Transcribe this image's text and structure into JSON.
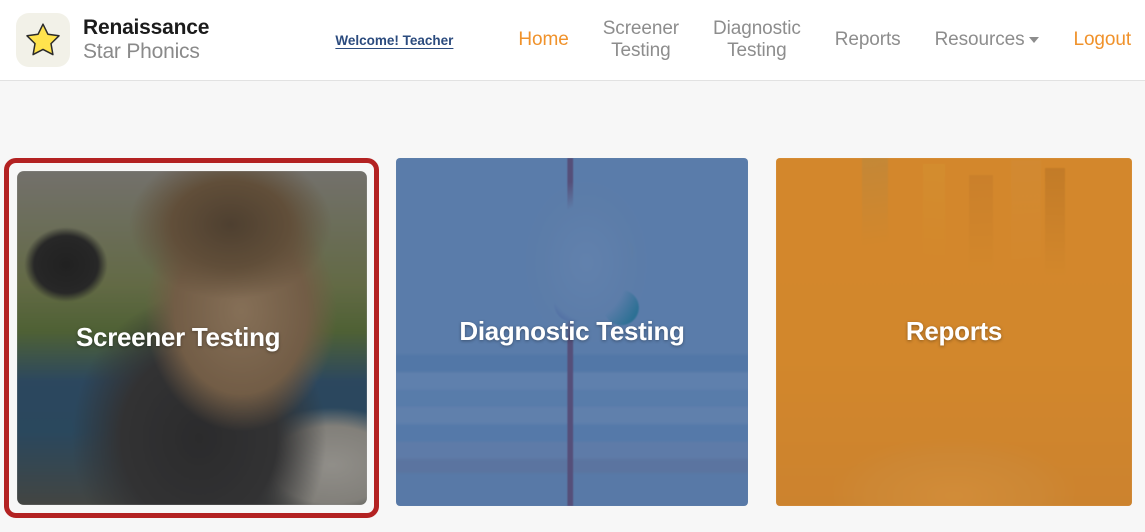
{
  "brand": {
    "logo_icon": "star-icon",
    "line1": "Renaissance",
    "line2": "Star Phonics",
    "logo_color": "#FFE34D",
    "logo_tile_color": "#F2F1E8"
  },
  "header": {
    "welcome_link": "Welcome! Teacher",
    "welcome_link_color": "#2B4B7E",
    "nav": [
      {
        "label": "Home",
        "active": true,
        "has_caret": false
      },
      {
        "label": "Screener\nTesting",
        "active": false,
        "has_caret": false
      },
      {
        "label": "Diagnostic\nTesting",
        "active": false,
        "has_caret": false
      },
      {
        "label": "Reports",
        "active": false,
        "has_caret": false
      },
      {
        "label": "Resources",
        "active": false,
        "has_caret": true
      },
      {
        "label": "Logout",
        "active": true,
        "has_caret": false
      }
    ],
    "accent_color": "#F0922B",
    "inactive_color": "#8D8D8D"
  },
  "main": {
    "background_color": "#F7F7F7",
    "focus_ring_color": "#B32222",
    "cards": [
      {
        "label": "Screener Testing",
        "image": "child-writing-photo",
        "tint_color": "#282828",
        "focused": true
      },
      {
        "label": "Diagnostic Testing",
        "image": "books-and-mug-photo",
        "tint_color": "#2A5591",
        "focused": false
      },
      {
        "label": "Reports",
        "image": "colored-pencils-photo",
        "tint_color": "#D68626",
        "focused": false
      }
    ]
  }
}
